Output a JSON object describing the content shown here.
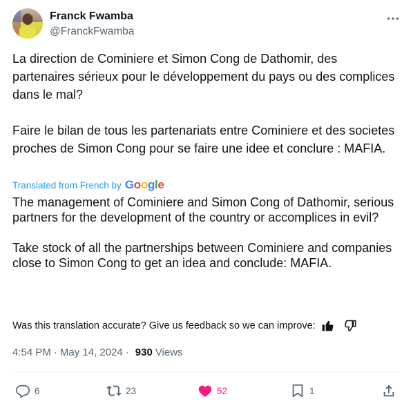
{
  "author": {
    "name": "Franck Fwamba",
    "handle": "@FranckFwamba"
  },
  "tweet": {
    "original_text": "La direction de Cominiere et Simon Cong de Dathomir, des partenaires sérieux pour le développement du pays ou des complices dans le mal?\n\nFaire le bilan de tous les partenariats entre Cominiere et des societes proches de Simon Cong pour se faire une idee et conclure : MAFIA.",
    "translated_label": "Translated from French by",
    "translated_text": "The management of Cominiere and Simon Cong of Dathomir, serious partners for the development of the country or accomplices in evil?\n\nTake stock of all the partnerships between Cominiere and companies close to Simon Cong to get an idea and conclude: MAFIA."
  },
  "feedback": {
    "question": "Was this translation accurate? Give us feedback so we can improve:"
  },
  "meta": {
    "time": "4:54 PM",
    "separator": "·",
    "date": "May 14, 2024",
    "views_count": "930",
    "views_label": "Views"
  },
  "actions": {
    "replies": "6",
    "retweets": "23",
    "likes": "52",
    "bookmarks": "1"
  },
  "colors": {
    "like_active": "#f91880",
    "link": "#1d9bf0",
    "muted": "#536471"
  }
}
